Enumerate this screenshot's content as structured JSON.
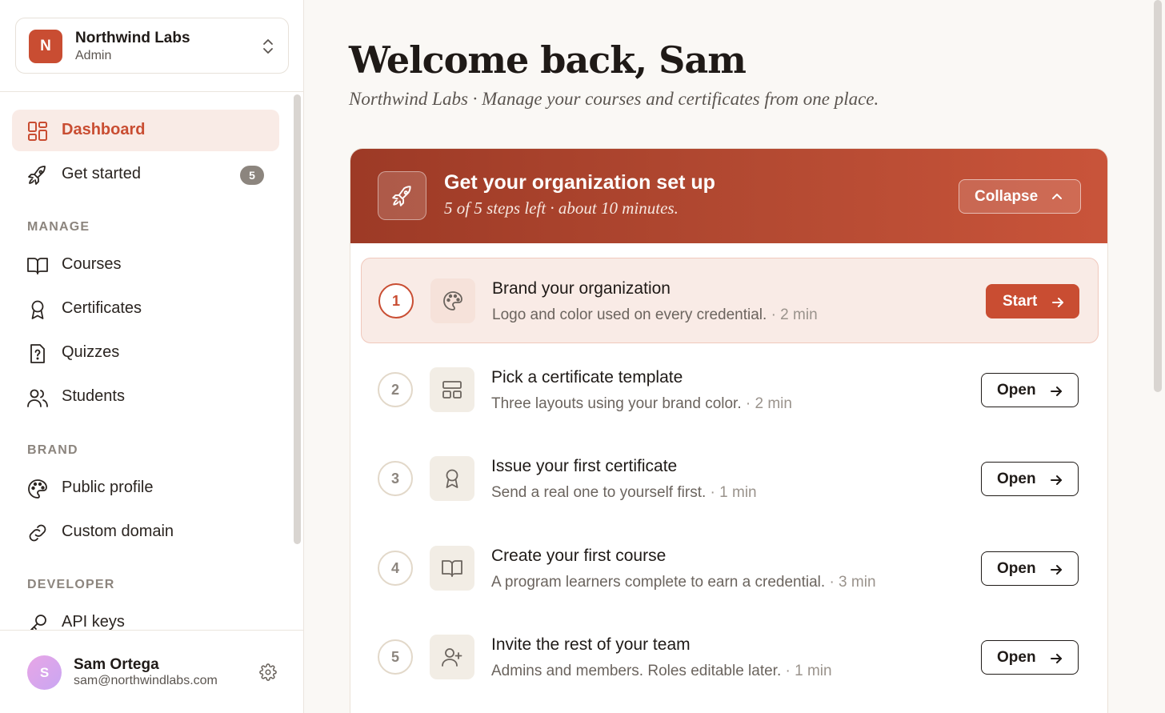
{
  "org": {
    "initial": "N",
    "name": "Northwind Labs",
    "role": "Admin"
  },
  "nav": {
    "dashboard": "Dashboard",
    "get_started": "Get started",
    "get_started_badge": "5",
    "sections": {
      "manage": "MANAGE",
      "brand": "BRAND",
      "developer": "DEVELOPER"
    },
    "courses": "Courses",
    "certificates": "Certificates",
    "quizzes": "Quizzes",
    "students": "Students",
    "public_profile": "Public profile",
    "custom_domain": "Custom domain",
    "api_keys": "API keys"
  },
  "user": {
    "initial": "S",
    "name": "Sam Ortega",
    "email": "sam@northwindlabs.com"
  },
  "page": {
    "title": "Welcome back, Sam",
    "subtitle": "Northwind Labs · Manage your courses and certificates from one place."
  },
  "setup": {
    "title": "Get your organization set up",
    "subtitle": "5 of 5 steps left · about 10 minutes.",
    "collapse_label": "Collapse",
    "steps": [
      {
        "num": "1",
        "title": "Brand your organization",
        "desc": "Logo and color used on every credential.",
        "time": "· 2 min",
        "button": "Start",
        "icon": "palette-icon"
      },
      {
        "num": "2",
        "title": "Pick a certificate template",
        "desc": "Three layouts using your brand color.",
        "time": "· 2 min",
        "button": "Open",
        "icon": "layout-icon"
      },
      {
        "num": "3",
        "title": "Issue your first certificate",
        "desc": "Send a real one to yourself first.",
        "time": "· 1 min",
        "button": "Open",
        "icon": "award-icon"
      },
      {
        "num": "4",
        "title": "Create your first course",
        "desc": "A program learners complete to earn a credential.",
        "time": "· 3 min",
        "button": "Open",
        "icon": "book-icon"
      },
      {
        "num": "5",
        "title": "Invite the rest of your team",
        "desc": "Admins and members. Roles editable later.",
        "time": "· 1 min",
        "button": "Open",
        "icon": "user-plus-icon"
      }
    ]
  },
  "colors": {
    "accent": "#c94d32",
    "header_dark": "#9d3a26",
    "background": "#faf8f5"
  }
}
